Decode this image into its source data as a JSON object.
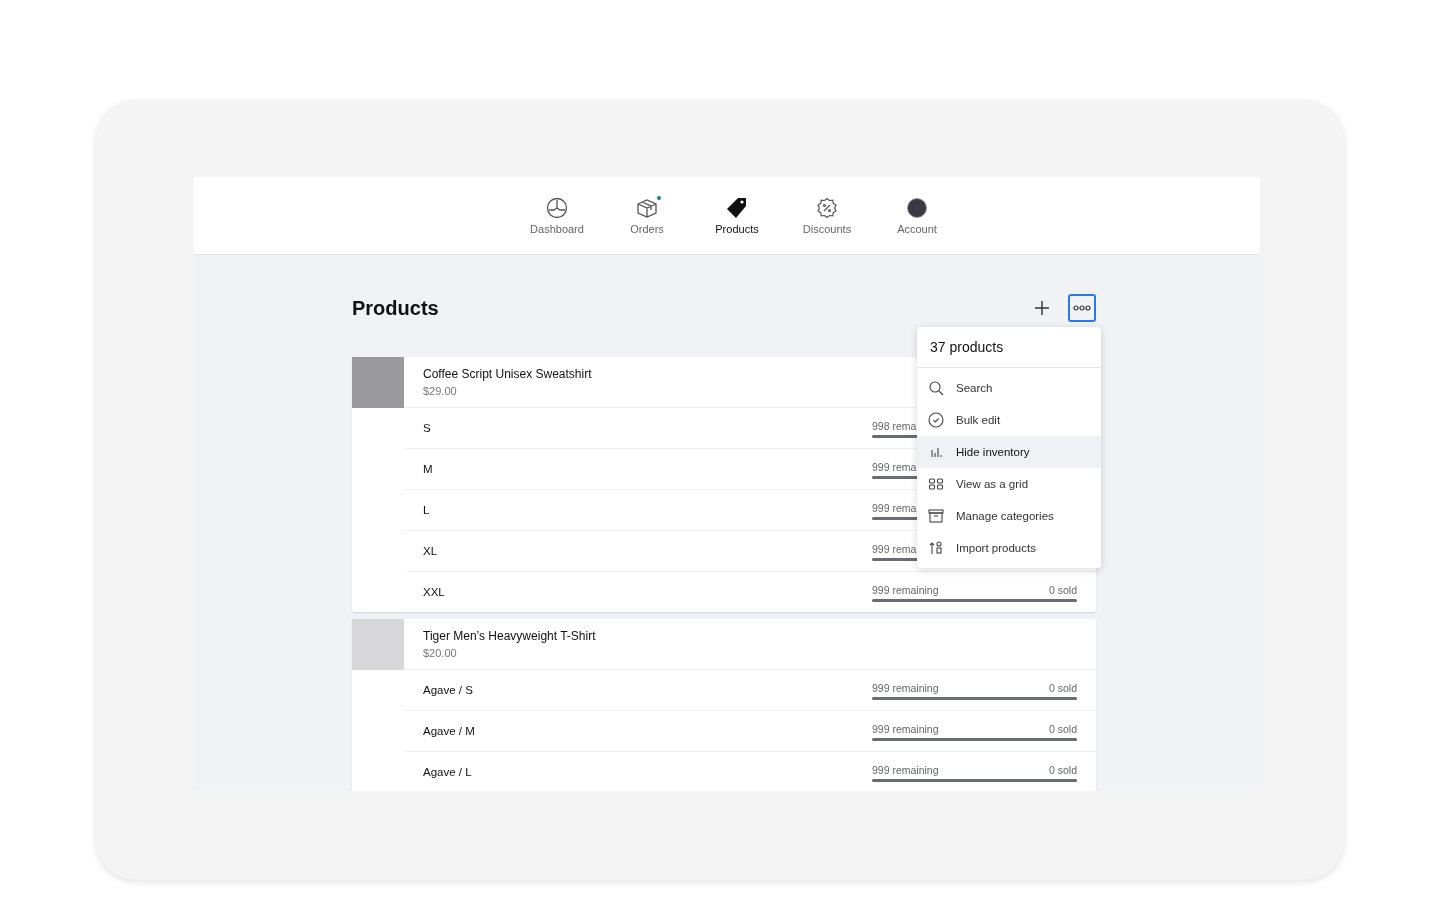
{
  "nav": {
    "items": [
      {
        "label": "Dashboard",
        "kind": "gauge",
        "selected": false,
        "badge": false
      },
      {
        "label": "Orders",
        "kind": "box",
        "selected": false,
        "badge": true
      },
      {
        "label": "Products",
        "kind": "tag",
        "selected": true,
        "badge": false
      },
      {
        "label": "Discounts",
        "kind": "percent",
        "selected": false,
        "badge": false
      },
      {
        "label": "Account",
        "kind": "avatar",
        "selected": false,
        "badge": false
      }
    ]
  },
  "page": {
    "title": "Products",
    "menu_open": true
  },
  "products": [
    {
      "name": "Coffee Script Unisex Sweatshirt",
      "price": "$29.00",
      "variants": [
        {
          "name": "S",
          "remaining": "998 rema",
          "level": 1
        },
        {
          "name": "M",
          "remaining": "999 rema",
          "level": 1
        },
        {
          "name": "L",
          "remaining": "999 rema",
          "level": 1
        },
        {
          "name": "XL",
          "remaining": "999 rema",
          "level": 1
        },
        {
          "name": "XXL",
          "remaining": "999 remaining",
          "sold": "0 sold",
          "level": 1
        }
      ]
    },
    {
      "name": "Tiger Men’s Heavyweight T-Shirt",
      "price": "$20.00",
      "variants": [
        {
          "name": "Agave / S",
          "remaining": "999 remaining",
          "sold": "0 sold",
          "level": 1
        },
        {
          "name": "Agave / M",
          "remaining": "999 remaining",
          "sold": "0 sold",
          "level": 1
        },
        {
          "name": "Agave / L",
          "remaining": "999 remaining",
          "sold": "0 sold",
          "level": 1
        }
      ]
    }
  ],
  "menu": {
    "header": "37 products",
    "items": [
      {
        "label": "Search",
        "kind": "search",
        "selected": false
      },
      {
        "label": "Bulk edit",
        "kind": "check",
        "selected": false
      },
      {
        "label": "Hide inventory",
        "kind": "bars",
        "selected": true
      },
      {
        "label": "View as a grid",
        "kind": "grid",
        "selected": false
      },
      {
        "label": "Manage categories",
        "kind": "archive",
        "selected": false
      },
      {
        "label": "Import products",
        "kind": "import",
        "selected": false
      }
    ]
  }
}
